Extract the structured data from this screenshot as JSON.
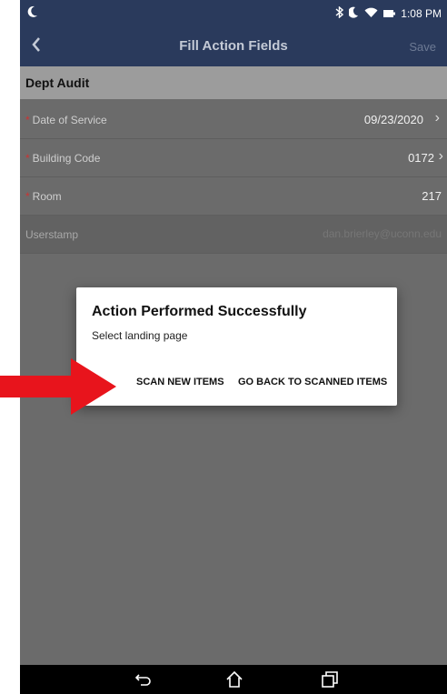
{
  "status_bar": {
    "left_icon": "moon-icon",
    "time": "1:08 PM",
    "icons": [
      "bluetooth-icon",
      "moon-icon",
      "wifi-icon",
      "battery-icon"
    ]
  },
  "app_bar": {
    "title": "Fill Action Fields",
    "save_label": "Save",
    "back_icon": "chevron-left-icon"
  },
  "form": {
    "section_title": "Dept Audit",
    "rows": [
      {
        "label": "Date of Service",
        "required": "*",
        "value": "09/23/2020"
      },
      {
        "label": "Building Code",
        "required": "*",
        "value": "0172"
      },
      {
        "label": "Room",
        "required": "*",
        "value": "217"
      },
      {
        "label": "Userstamp",
        "required": "",
        "value": "dan.brierley@uconn.edu"
      }
    ]
  },
  "dialog": {
    "title": "Action Performed Successfully",
    "message": "Select landing page",
    "buttons": [
      "SCAN NEW ITEMS",
      "GO BACK TO SCANNED ITEMS"
    ]
  },
  "annotation": {
    "color": "#e8141c",
    "icon": "red-arrow-annotation"
  },
  "nav_bar": {
    "icons": [
      "back-icon",
      "home-icon",
      "recents-icon"
    ]
  }
}
